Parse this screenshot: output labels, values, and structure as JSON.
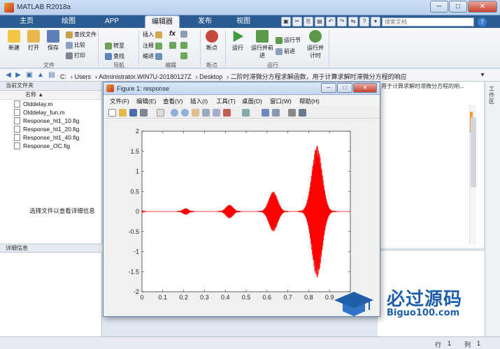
{
  "window": {
    "title": "MATLAB R2018a",
    "minimize": "─",
    "maximize": "□",
    "close": "✕"
  },
  "tabs": [
    {
      "label": "主页"
    },
    {
      "label": "绘图"
    },
    {
      "label": "APP"
    },
    {
      "label": "编辑器"
    },
    {
      "label": "发布"
    },
    {
      "label": "视图"
    }
  ],
  "search": {
    "placeholder": "搜索文档"
  },
  "help": "?",
  "ribbon": {
    "file": {
      "new": "新建",
      "open": "打开",
      "save": "保存",
      "find_file": "查找文件",
      "compare": "比较",
      "print": "打印",
      "group": "文件"
    },
    "navigate": {
      "goto": "转至",
      "find": "查找",
      "group": "导航"
    },
    "edit": {
      "insert": "插入",
      "comment": "注释",
      "indent": "缩进",
      "fx": "fx",
      "group": "编辑"
    },
    "breakpoints": {
      "breakpoints": "断点",
      "group": "断点"
    },
    "run": {
      "run": "运行",
      "run_advance": "运行并前进",
      "run_section": "运行节",
      "advance": "前进",
      "run_time": "运行并计时",
      "group": "运行"
    }
  },
  "address": {
    "segments": [
      "C:",
      "Users",
      "Administrator.WIN7U-20180127Z",
      "Desktop",
      "二阶时滞微分方程求解函数，用于计算求解时滞微分方程的响应"
    ]
  },
  "current_folder": {
    "title": "当前文件夹",
    "column": "名称 ▲",
    "files": [
      "Olddelay.m",
      "Olddelay_fun.m",
      "Response_ht1_10.fig",
      "Response_ht1_20.fig",
      "Response_ht1_40.fig",
      "Response_OC.fig"
    ]
  },
  "details": {
    "title": "详细信息",
    "message": "选择文件以查看详细信息"
  },
  "editor_tab": "用于计算求解时滞微分方程的响...",
  "workspace_label": "工作区",
  "status": {
    "row_label": "行",
    "row": "1",
    "col_label": "列",
    "col": "1"
  },
  "figure": {
    "title": "Figure 1: response",
    "menu": [
      "文件(F)",
      "编辑(E)",
      "查看(V)",
      "插入(I)",
      "工具(T)",
      "桌面(D)",
      "窗口(W)",
      "帮助(H)"
    ]
  },
  "watermark": {
    "cn": "必过源码",
    "en": "Biguo100.com"
  },
  "chart_data": {
    "type": "line",
    "title": "",
    "xlabel": "",
    "ylabel": "",
    "xlim": [
      0,
      1
    ],
    "ylim": [
      -2,
      2
    ],
    "xticks": [
      "0",
      "0.1",
      "0.2",
      "0.3",
      "0.4",
      "0.5",
      "0.6",
      "0.7",
      "0.8",
      "0.9"
    ],
    "yticks": [
      "2",
      "1.5",
      "1",
      "0.5",
      "0",
      "-0.5",
      "-1",
      "-1.5",
      "-2"
    ],
    "color": "#ff0000",
    "bursts": [
      {
        "center": 0.0,
        "amplitude": 0.03,
        "width": 0.01
      },
      {
        "center": 0.21,
        "amplitude": 0.08,
        "width": 0.02
      },
      {
        "center": 0.42,
        "amplitude": 0.17,
        "width": 0.025
      },
      {
        "center": 0.63,
        "amplitude": 0.5,
        "width": 0.03
      },
      {
        "center": 0.84,
        "amplitude": 1.65,
        "width": 0.035
      }
    ]
  }
}
